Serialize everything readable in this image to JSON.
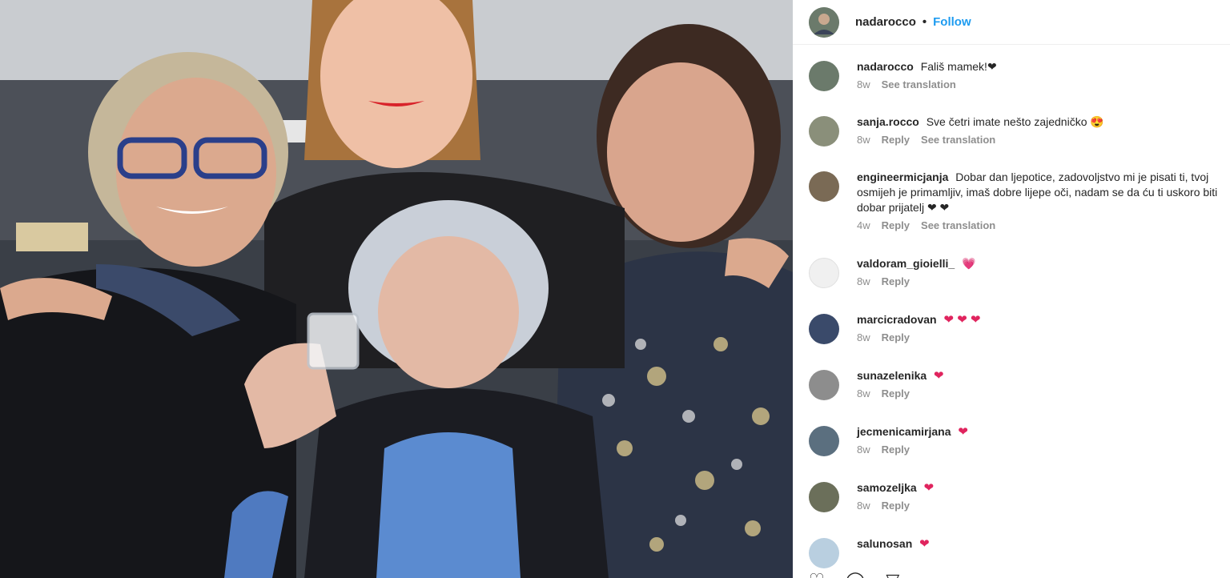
{
  "post": {
    "username": "nadarocco",
    "separator": "•",
    "follow_label": "Follow"
  },
  "comments": [
    {
      "user": "nadarocco",
      "text": "Fališ mamek!❤",
      "time": "8w",
      "actions": [
        "See translation"
      ],
      "avatar_color": "#6b7a6b"
    },
    {
      "user": "sanja.rocco",
      "text": "Sve četri imate nešto zajedničko 😍",
      "time": "8w",
      "actions": [
        "Reply",
        "See translation"
      ],
      "avatar_color": "#8a8f7a"
    },
    {
      "user": "engineermicjanja",
      "text": "Dobar dan ljepotice, zadovoljstvo mi je pisati ti, tvoj osmijeh je primamljiv, imaš dobre lijepe oči, nadam se da ću ti uskoro biti dobar prijatelj ❤ ❤",
      "time": "4w",
      "actions": [
        "Reply",
        "See translation"
      ],
      "avatar_color": "#7a6a55"
    },
    {
      "user": "valdoram_gioielli_",
      "text": "💗",
      "time": "8w",
      "actions": [
        "Reply"
      ],
      "avatar_color": "#f0f0f0"
    },
    {
      "user": "marcicradovan",
      "text": "❤ ❤ ❤",
      "time": "8w",
      "actions": [
        "Reply"
      ],
      "avatar_color": "#3a4a6a"
    },
    {
      "user": "sunazelenika",
      "text": "❤",
      "time": "8w",
      "actions": [
        "Reply"
      ],
      "avatar_color": "#8d8d8d"
    },
    {
      "user": "jecmenicamirjana",
      "text": "❤",
      "time": "8w",
      "actions": [
        "Reply"
      ],
      "avatar_color": "#5b6f7f"
    },
    {
      "user": "samozeljka",
      "text": "❤",
      "time": "8w",
      "actions": [
        "Reply"
      ],
      "avatar_color": "#6b6f5a"
    },
    {
      "user": "salunosan",
      "text": "❤",
      "time": "",
      "actions": [],
      "avatar_color": "#b9cfe0"
    }
  ],
  "icons": [
    "heart-icon",
    "comment-icon",
    "share-icon"
  ],
  "colors": {
    "link": "#1d9bf0",
    "heart": "#e0245e",
    "meta": "#8e8e8e"
  }
}
